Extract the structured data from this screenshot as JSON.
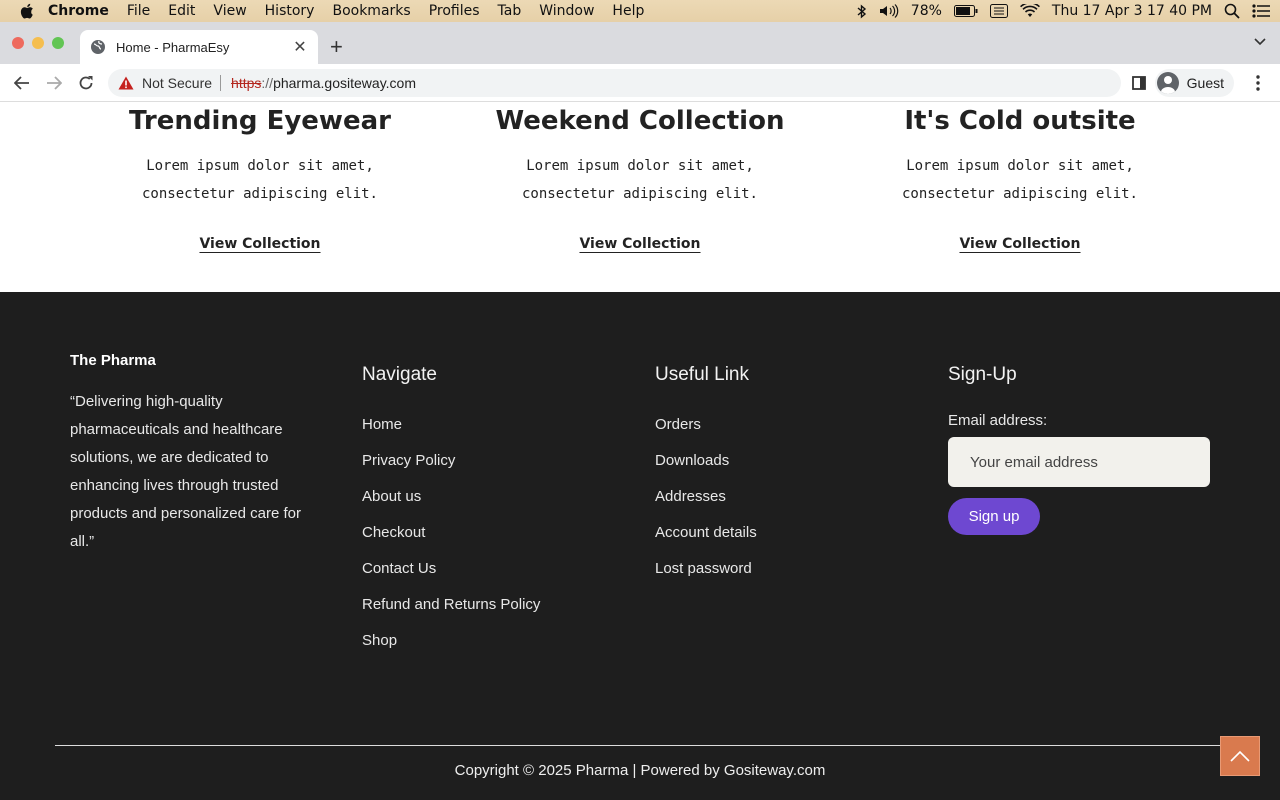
{
  "menubar": {
    "app": "Chrome",
    "items": [
      "File",
      "Edit",
      "View",
      "History",
      "Bookmarks",
      "Profiles",
      "Tab",
      "Window",
      "Help"
    ],
    "battery": "78%",
    "datetime": "Thu 17 Apr  3 17 40 PM"
  },
  "browser": {
    "tab_title": "Home - PharmaEsy",
    "security_label": "Not Secure",
    "url_scheme": "https",
    "url_sep": "://",
    "url_host": "pharma.gositeway.com",
    "profile_label": "Guest"
  },
  "collections": [
    {
      "title": "Trending Eyewear",
      "desc": "Lorem ipsum dolor sit amet, consectetur adipiscing elit.",
      "link": "View Collection"
    },
    {
      "title": "Weekend Collection",
      "desc": "Lorem ipsum dolor sit amet, consectetur adipiscing elit.",
      "link": "View Collection"
    },
    {
      "title": "It's Cold outsite",
      "desc": "Lorem ipsum dolor sit amet, consectetur adipiscing elit.",
      "link": "View Collection"
    }
  ],
  "footer": {
    "brand": "The Pharma",
    "tagline": "“Delivering high-quality pharmaceuticals and healthcare solutions, we are dedicated to enhancing lives through trusted products and personalized care for all.”",
    "navigate": {
      "heading": "Navigate",
      "links": [
        "Home",
        "Privacy Policy",
        "About us",
        "Checkout",
        "Contact Us",
        "Refund and Returns Policy",
        "Shop"
      ]
    },
    "useful": {
      "heading": "Useful Link",
      "links": [
        "Orders",
        "Downloads",
        "Addresses",
        "Account details",
        "Lost password"
      ]
    },
    "signup": {
      "heading": "Sign-Up",
      "email_label": "Email address:",
      "email_placeholder": "Your email address",
      "button": "Sign up"
    },
    "copyright": "Copyright © 2025 Pharma | Powered by Gositeway.com"
  }
}
